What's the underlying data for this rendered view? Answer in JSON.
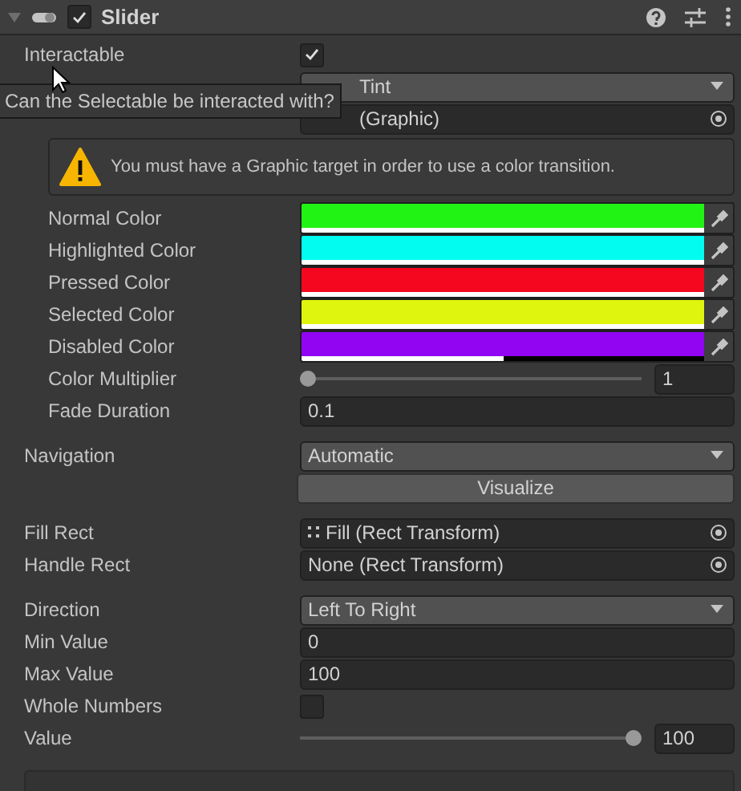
{
  "component": {
    "title": "Slider",
    "enabled": true,
    "expanded": true
  },
  "tooltip": {
    "text": "Can the Selectable be interacted with?"
  },
  "groups": [
    [
      {
        "kind": "checkbox",
        "label": "Interactable",
        "checked": true
      },
      {
        "kind": "dropdown",
        "value": "Tint",
        "partial": true,
        "children": [
          {
            "kind": "object",
            "value": "(Graphic)",
            "partial": true
          },
          {
            "kind": "warning",
            "text": "You must have a Graphic target in order to use a color transition."
          },
          {
            "kind": "color",
            "label": "Normal Color",
            "color": "#21f414",
            "level": 1
          },
          {
            "kind": "color",
            "label": "Highlighted Color",
            "color": "#02fdf0",
            "level": 1
          },
          {
            "kind": "color",
            "label": "Pressed Color",
            "color": "#f5081f",
            "level": 1
          },
          {
            "kind": "color",
            "label": "Selected Color",
            "color": "#e0f50d",
            "level": 1
          },
          {
            "kind": "color",
            "label": "Disabled Color",
            "color": "#9205f3",
            "level": 0.5
          },
          {
            "kind": "slider",
            "label": "Color Multiplier",
            "level": 0,
            "value": "1"
          },
          {
            "kind": "number",
            "label": "Fade Duration",
            "value": "0.1"
          }
        ]
      }
    ],
    [
      {
        "kind": "dropdown",
        "label": "Navigation",
        "value": "Automatic"
      },
      {
        "kind": "button",
        "value": "Visualize"
      }
    ],
    [
      {
        "kind": "object",
        "label": "Fill Rect",
        "value": "Fill (Rect Transform)",
        "linked": true
      },
      {
        "kind": "object",
        "label": "Handle Rect",
        "value": "None (Rect Transform)"
      }
    ],
    [
      {
        "kind": "dropdown",
        "label": "Direction",
        "value": "Left To Right"
      },
      {
        "kind": "number",
        "label": "Min Value",
        "value": "0"
      },
      {
        "kind": "number",
        "label": "Max Value",
        "value": "100"
      },
      {
        "kind": "checkbox",
        "label": "Whole Numbers",
        "checked": false
      },
      {
        "kind": "slider",
        "label": "Value",
        "level": 1,
        "value": "100"
      }
    ]
  ]
}
